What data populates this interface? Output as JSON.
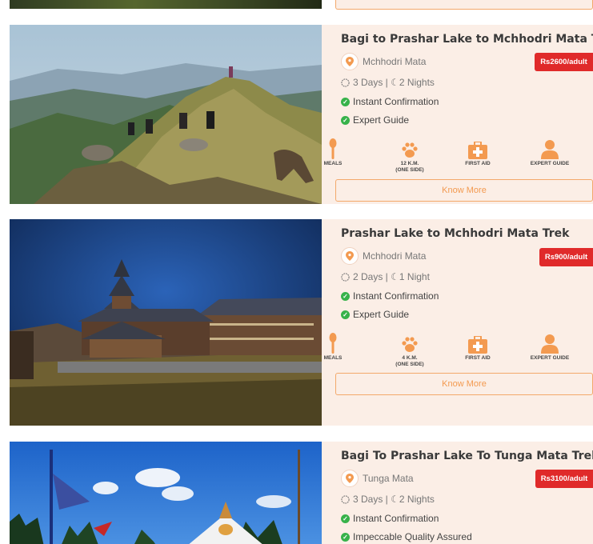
{
  "colors": {
    "card_bg": "#fbeee6",
    "price_bg": "#e02a2a",
    "accent": "#f39a50",
    "check": "#37b24a"
  },
  "cards": [
    {
      "title": "Bagi to Prashar Lake to Mchhodri Mata Trek",
      "location": "Mchhodri Mata",
      "price": "Rs2600/adult",
      "duration": "3 Days | ☾2 Nights",
      "features": [
        "Instant Confirmation",
        "Expert Guide"
      ],
      "amenities": [
        {
          "icon": "meals-icon",
          "label": "MEALS"
        },
        {
          "icon": "paw-icon",
          "label": "12 K.M.",
          "sub": "(ONE SIDE)"
        },
        {
          "icon": "first-aid-icon",
          "label": "FIRST AID"
        },
        {
          "icon": "guide-icon",
          "label": "EXPERT GUIDE"
        }
      ],
      "cta": "Know More"
    },
    {
      "title": "Prashar Lake to Mchhodri Mata Trek",
      "location": "Mchhodri Mata",
      "price": "Rs900/adult",
      "duration": "2 Days | ☾1 Night",
      "features": [
        "Instant Confirmation",
        "Expert Guide"
      ],
      "amenities": [
        {
          "icon": "meals-icon",
          "label": "MEALS"
        },
        {
          "icon": "paw-icon",
          "label": "4 K.M.",
          "sub": "(ONE SIDE)"
        },
        {
          "icon": "first-aid-icon",
          "label": "FIRST AID"
        },
        {
          "icon": "guide-icon",
          "label": "EXPERT GUIDE"
        }
      ],
      "cta": "Know More"
    },
    {
      "title": "Bagi To Prashar Lake To Tunga Mata Trek",
      "location": "Tunga Mata",
      "price": "Rs3100/adult",
      "duration": "3 Days | ☾2 Nights",
      "features": [
        "Instant Confirmation",
        "Impeccable Quality Assured"
      ]
    }
  ]
}
